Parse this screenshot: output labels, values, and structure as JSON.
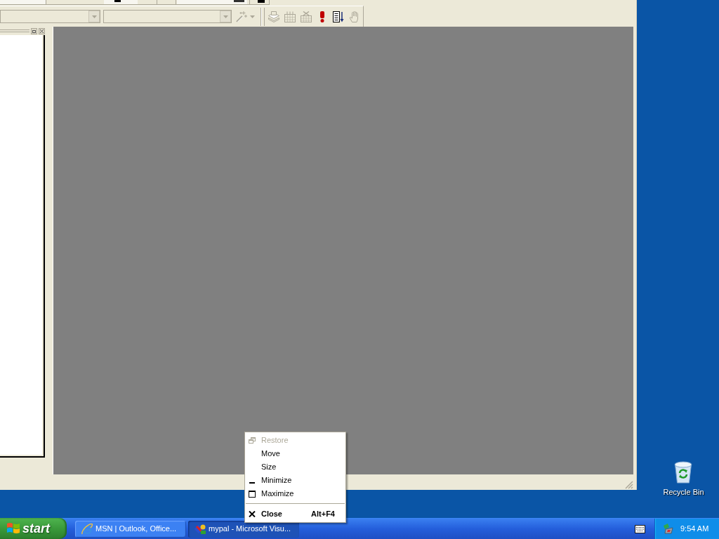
{
  "toolbar": {
    "combo_boxes": [
      {
        "disabled": true
      },
      {
        "disabled": true
      }
    ],
    "buttons": [
      {
        "kind": "wand",
        "disabled": true,
        "dropdown": true
      },
      {
        "kind": "separator"
      },
      {
        "kind": "stack",
        "disabled": true,
        "dropdown": false
      },
      {
        "kind": "grid",
        "disabled": true,
        "dropdown": false
      },
      {
        "kind": "grid_delete",
        "disabled": true,
        "dropdown": false
      },
      {
        "kind": "exclamation",
        "disabled": false,
        "dropdown": false
      },
      {
        "kind": "list_arrow",
        "disabled": false,
        "dropdown": false
      },
      {
        "kind": "hand",
        "disabled": true,
        "dropdown": false
      }
    ]
  },
  "context_menu": {
    "items": [
      {
        "kind": "restore",
        "label": "Restore",
        "disabled": true,
        "default": false
      },
      {
        "kind": "move",
        "label": "Move",
        "disabled": false,
        "default": false
      },
      {
        "kind": "size",
        "label": "Size",
        "disabled": false,
        "default": false
      },
      {
        "kind": "minimize",
        "label": "Minimize",
        "disabled": false,
        "default": false
      },
      {
        "kind": "maximize",
        "label": "Maximize",
        "disabled": false,
        "default": false
      },
      {
        "kind": "separator"
      },
      {
        "kind": "close",
        "label": "Close",
        "shortcut": "Alt+F4",
        "disabled": false,
        "default": true
      }
    ]
  },
  "taskbar": {
    "start_button": {
      "label": "start"
    },
    "tasks": [
      {
        "kind": "browser",
        "label": "MSN | Outlook, Office...",
        "selected": false
      },
      {
        "kind": "ide",
        "label": "mypal - Microsoft Visu...",
        "selected": true
      }
    ],
    "clock": "9:54 AM"
  },
  "desktop": {
    "icons": [
      {
        "label": "Recycle Bin"
      }
    ]
  }
}
